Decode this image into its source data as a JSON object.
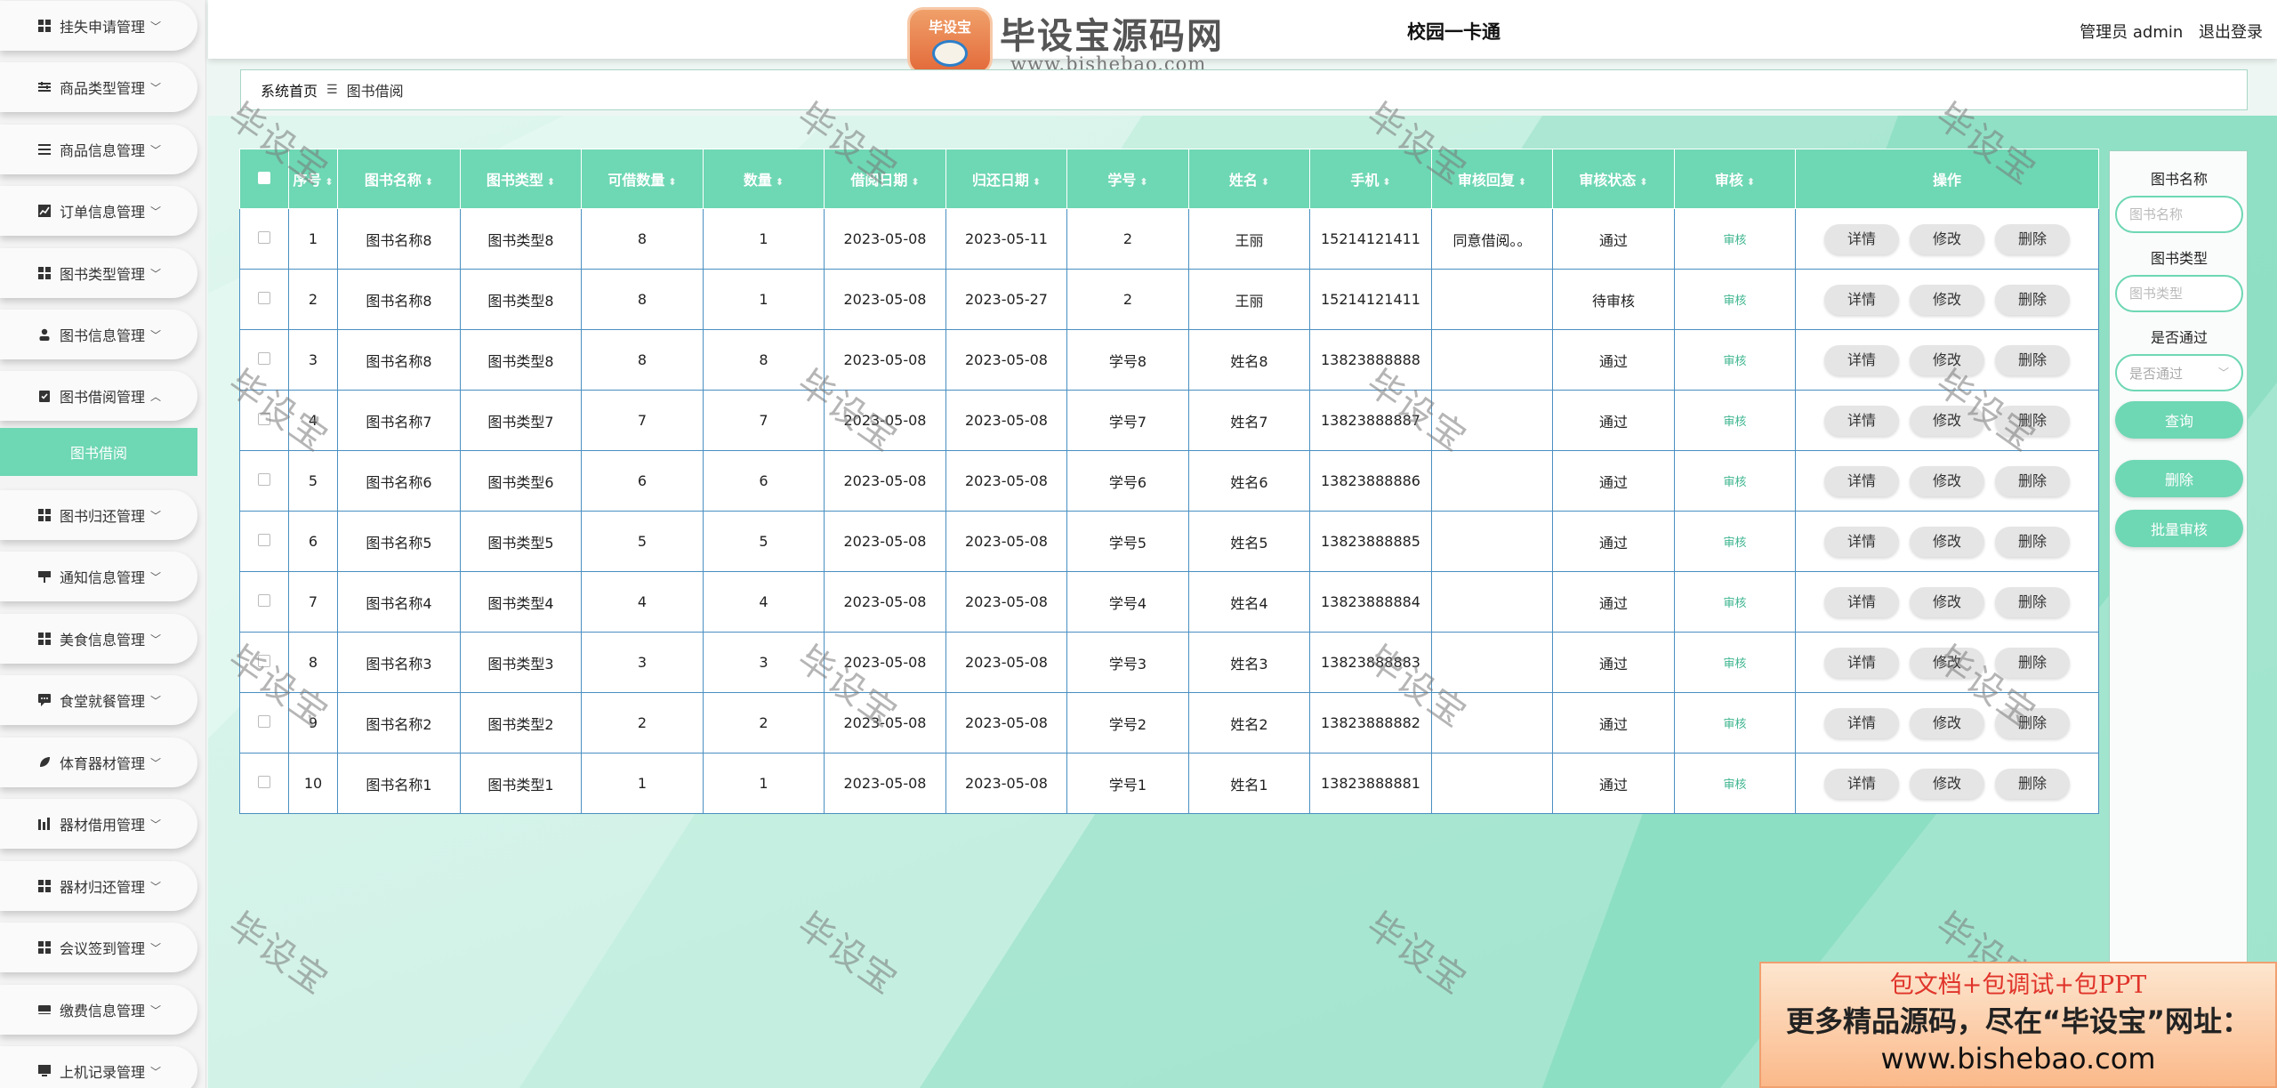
{
  "header": {
    "title": "校园一卡通",
    "user_label": "管理员 admin",
    "logout_label": "退出登录"
  },
  "watermark": {
    "badge_text": "毕设宝",
    "brand": "毕设宝源码网",
    "url": "www.bishebao.com",
    "diagonal_text": "毕设宝"
  },
  "sidebar": {
    "items": [
      {
        "label": "挂失申请管理",
        "icon": "grid-icon",
        "arrow": "﹀"
      },
      {
        "label": "商品类型管理",
        "icon": "sliders-icon",
        "arrow": "﹀"
      },
      {
        "label": "商品信息管理",
        "icon": "list-icon",
        "arrow": "﹀"
      },
      {
        "label": "订单信息管理",
        "icon": "chart-icon",
        "arrow": "﹀"
      },
      {
        "label": "图书类型管理",
        "icon": "grid-icon",
        "arrow": "﹀"
      },
      {
        "label": "图书信息管理",
        "icon": "person-icon",
        "arrow": "﹀"
      },
      {
        "label": "图书借阅管理",
        "icon": "clipboard-icon",
        "arrow": "︿"
      },
      {
        "label": "图书归还管理",
        "icon": "grid-icon",
        "arrow": "﹀"
      },
      {
        "label": "通知信息管理",
        "icon": "sign-icon",
        "arrow": "﹀"
      },
      {
        "label": "美食信息管理",
        "icon": "grid-icon",
        "arrow": "﹀"
      },
      {
        "label": "食堂就餐管理",
        "icon": "chat-icon",
        "arrow": "﹀"
      },
      {
        "label": "体育器材管理",
        "icon": "leaf-icon",
        "arrow": "﹀"
      },
      {
        "label": "器材借用管理",
        "icon": "bars-icon",
        "arrow": "﹀"
      },
      {
        "label": "器材归还管理",
        "icon": "grid-icon",
        "arrow": "﹀"
      },
      {
        "label": "会议签到管理",
        "icon": "grid-icon",
        "arrow": "﹀"
      },
      {
        "label": "缴费信息管理",
        "icon": "card-icon",
        "arrow": "﹀"
      },
      {
        "label": "上机记录管理",
        "icon": "monitor-icon",
        "arrow": "﹀"
      }
    ],
    "active_sub": "图书借阅"
  },
  "breadcrumb": {
    "home": "系统首页",
    "sep": "☰",
    "current": "图书借阅"
  },
  "table": {
    "columns": [
      "序号",
      "图书名称",
      "图书类型",
      "可借数量",
      "数量",
      "借阅日期",
      "归还日期",
      "学号",
      "姓名",
      "手机",
      "审核回复",
      "审核状态",
      "审核",
      "操作"
    ],
    "sortable_icon": "⬍",
    "audit_label": "审核",
    "btn_detail": "详情",
    "btn_edit": "修改",
    "btn_delete": "删除",
    "rows": [
      [
        "1",
        "图书名称8",
        "图书类型8",
        "8",
        "1",
        "2023-05-08",
        "2023-05-11",
        "2",
        "王丽",
        "15214121411",
        "同意借阅。。",
        "通过"
      ],
      [
        "2",
        "图书名称8",
        "图书类型8",
        "8",
        "1",
        "2023-05-08",
        "2023-05-27",
        "2",
        "王丽",
        "15214121411",
        "",
        "待审核"
      ],
      [
        "3",
        "图书名称8",
        "图书类型8",
        "8",
        "8",
        "2023-05-08",
        "2023-05-08",
        "学号8",
        "姓名8",
        "13823888888",
        "",
        "通过"
      ],
      [
        "4",
        "图书名称7",
        "图书类型7",
        "7",
        "7",
        "2023-05-08",
        "2023-05-08",
        "学号7",
        "姓名7",
        "13823888887",
        "",
        "通过"
      ],
      [
        "5",
        "图书名称6",
        "图书类型6",
        "6",
        "6",
        "2023-05-08",
        "2023-05-08",
        "学号6",
        "姓名6",
        "13823888886",
        "",
        "通过"
      ],
      [
        "6",
        "图书名称5",
        "图书类型5",
        "5",
        "5",
        "2023-05-08",
        "2023-05-08",
        "学号5",
        "姓名5",
        "13823888885",
        "",
        "通过"
      ],
      [
        "7",
        "图书名称4",
        "图书类型4",
        "4",
        "4",
        "2023-05-08",
        "2023-05-08",
        "学号4",
        "姓名4",
        "13823888884",
        "",
        "通过"
      ],
      [
        "8",
        "图书名称3",
        "图书类型3",
        "3",
        "3",
        "2023-05-08",
        "2023-05-08",
        "学号3",
        "姓名3",
        "13823888883",
        "",
        "通过"
      ],
      [
        "9",
        "图书名称2",
        "图书类型2",
        "2",
        "2",
        "2023-05-08",
        "2023-05-08",
        "学号2",
        "姓名2",
        "13823888882",
        "",
        "通过"
      ],
      [
        "10",
        "图书名称1",
        "图书类型1",
        "1",
        "1",
        "2023-05-08",
        "2023-05-08",
        "学号1",
        "姓名1",
        "13823888881",
        "",
        "通过"
      ]
    ]
  },
  "search": {
    "book_name_label": "图书名称",
    "book_name_placeholder": "图书名称",
    "book_type_label": "图书类型",
    "book_type_placeholder": "图书类型",
    "passed_label": "是否通过",
    "passed_placeholder": "是否通过",
    "query_btn": "查询",
    "delete_btn": "删除",
    "batch_audit_btn": "批量审核"
  },
  "ad": {
    "line1": "包文档+包调试+包PPT",
    "line2": "更多精品源码，尽在“毕设宝”网址：",
    "line3": "www.bishebao.com"
  },
  "colors": {
    "accent": "#6ed7b4",
    "table_border": "#4a8fc1",
    "audit_link": "#3fb58f"
  }
}
